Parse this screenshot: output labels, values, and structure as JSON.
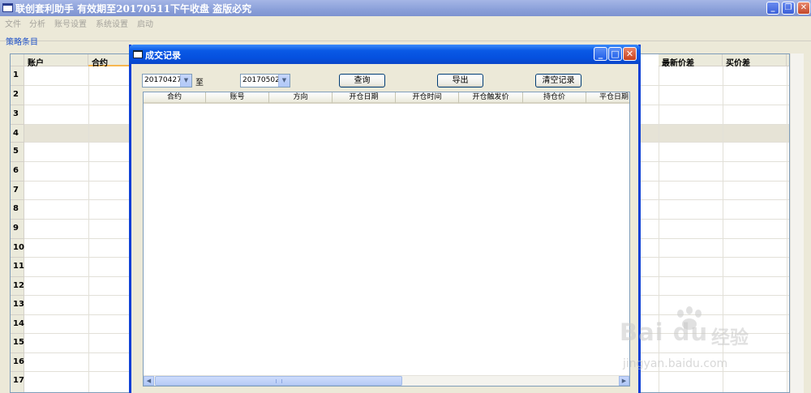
{
  "main_window": {
    "title": "联创套利助手 有效期至20170511下午收盘 盗版必究",
    "buttons": {
      "minimize": "_",
      "restore": "❐",
      "close": "✕"
    }
  },
  "menu": [
    "文件",
    "分析",
    "账号设置",
    "系统设置",
    "启动"
  ],
  "strategy_group": {
    "label": "策略条目",
    "columns": {
      "account": "账户",
      "contract": "合约",
      "latest_spread": "最新价差",
      "buy_spread": "买价差"
    },
    "row_numbers": [
      "1",
      "2",
      "3",
      "4",
      "5",
      "6",
      "7",
      "8",
      "9",
      "10",
      "11",
      "12",
      "13",
      "14",
      "15",
      "16",
      "17"
    ],
    "selected_row": "4"
  },
  "dialog": {
    "title": "成交记录",
    "start_date": "20170427",
    "to_label": "至",
    "end_date": "20170502",
    "buttons": {
      "query": "查询",
      "export": "导出",
      "clear": "清空记录"
    },
    "columns": [
      "合约",
      "账号",
      "方向",
      "开仓日期",
      "开仓时间",
      "开仓触发价",
      "持仓价",
      "平仓日期"
    ],
    "rows": []
  },
  "watermark": {
    "brand": "Bai du",
    "brand_cn": "经验",
    "url": "jingyan.baidu.com"
  },
  "colors": {
    "dialog_title": "#0550de",
    "group_label": "#1c4fc8",
    "sort_underline": "#f7b64f"
  }
}
